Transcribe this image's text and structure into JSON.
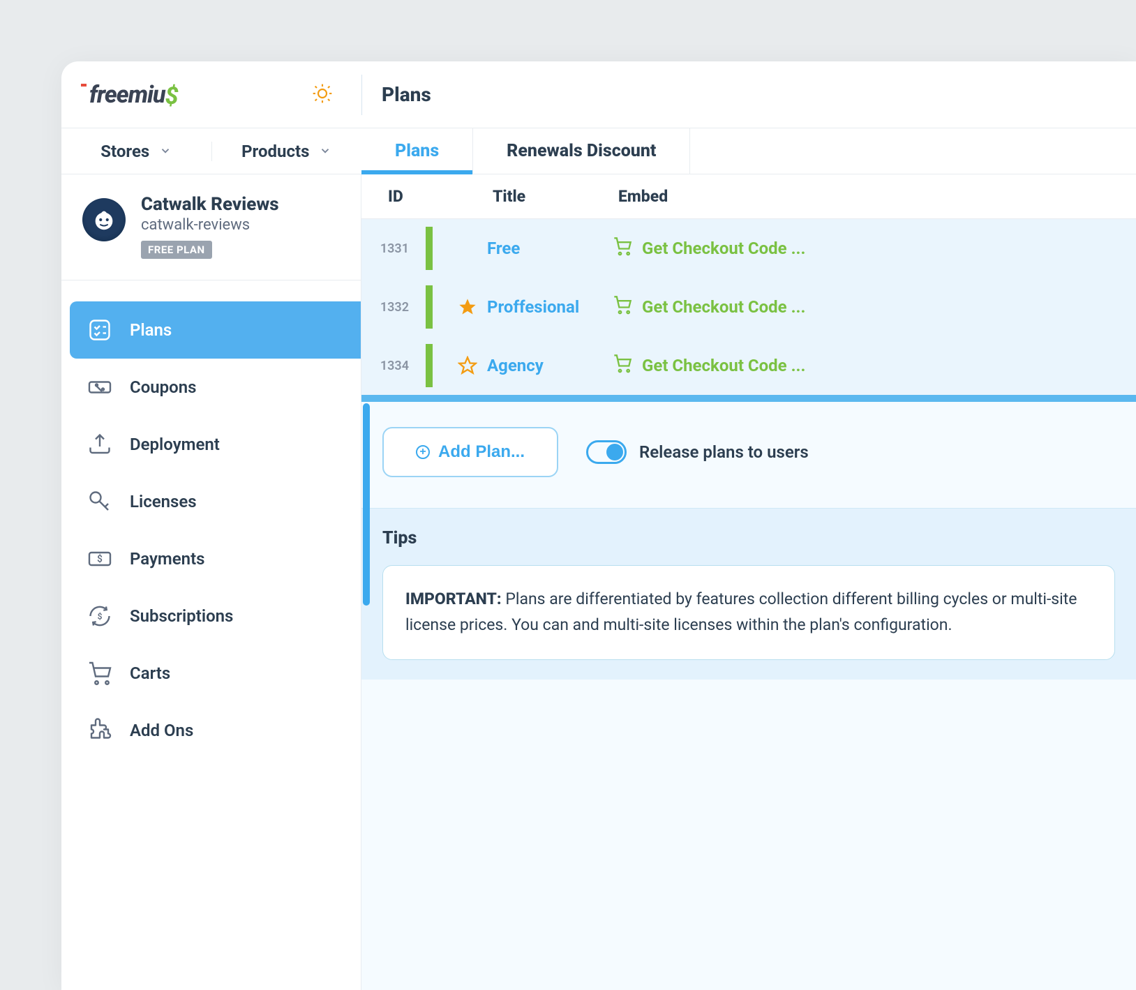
{
  "brand": "freemius",
  "header": {
    "page_title": "Plans"
  },
  "nav": {
    "stores": "Stores",
    "products": "Products"
  },
  "tabs": {
    "plans": "Plans",
    "renewals": "Renewals Discount"
  },
  "product": {
    "name": "Catwalk Reviews",
    "slug": "catwalk-reviews",
    "badge": "FREE PLAN"
  },
  "sidebar": {
    "items": [
      {
        "label": "Plans"
      },
      {
        "label": "Coupons"
      },
      {
        "label": "Deployment"
      },
      {
        "label": "Licenses"
      },
      {
        "label": "Payments"
      },
      {
        "label": "Subscriptions"
      },
      {
        "label": "Carts"
      },
      {
        "label": "Add Ons"
      }
    ]
  },
  "table": {
    "headers": {
      "id": "ID",
      "title": "Title",
      "embed": "Embed"
    },
    "rows": [
      {
        "id": "1331",
        "title": "Free",
        "embed": "Get Checkout Code ...",
        "starred": false,
        "star_outline": false
      },
      {
        "id": "1332",
        "title": "Proffesional",
        "embed": "Get Checkout Code ...",
        "starred": true,
        "star_outline": false
      },
      {
        "id": "1334",
        "title": "Agency",
        "embed": "Get Checkout Code ...",
        "starred": false,
        "star_outline": true
      }
    ]
  },
  "actions": {
    "add_plan": "Add Plan...",
    "release_toggle": "Release plans to users"
  },
  "tips": {
    "title": "Tips",
    "important_label": "IMPORTANT:",
    "body": " Plans are differentiated by features collection different billing cycles or multi-site license prices. You can and multi-site licenses within the plan's configuration."
  }
}
